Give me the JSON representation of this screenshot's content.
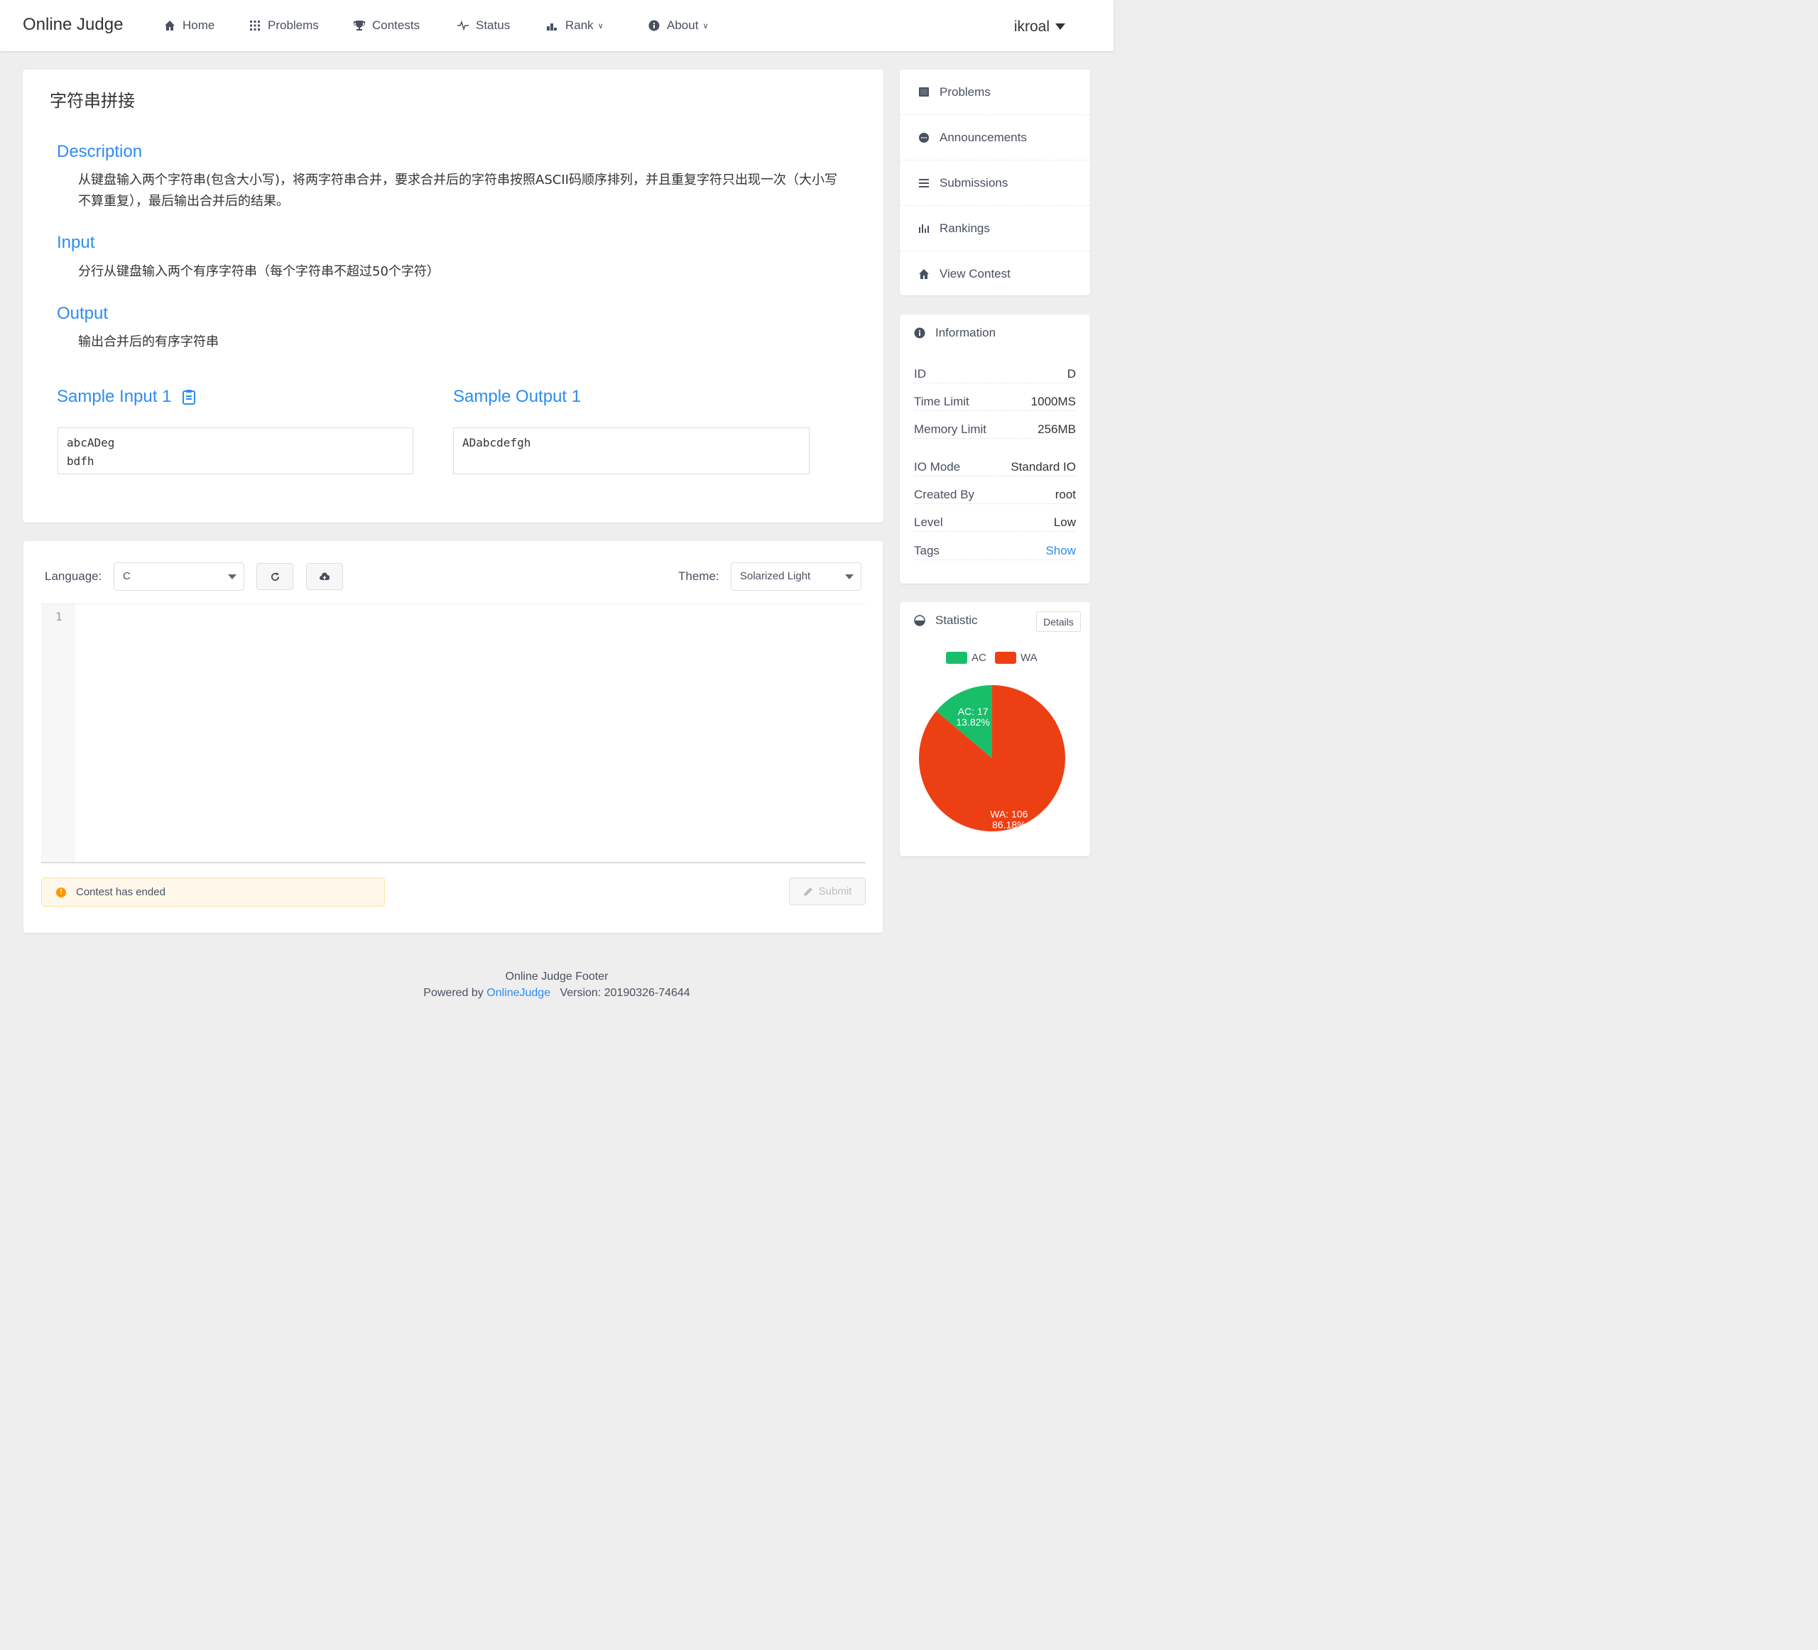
{
  "header": {
    "logo": "Online Judge",
    "nav": [
      {
        "label": "Home",
        "icon": "home-icon"
      },
      {
        "label": "Problems",
        "icon": "grid-icon"
      },
      {
        "label": "Contests",
        "icon": "trophy-icon"
      },
      {
        "label": "Status",
        "icon": "pulse-icon"
      },
      {
        "label": "Rank",
        "icon": "bar-chart-icon"
      },
      {
        "label": "About",
        "icon": "info-icon"
      }
    ],
    "user": "ikroal"
  },
  "problem": {
    "title": "字符串拼接",
    "description_label": "Description",
    "description": "从键盘输入两个字符串(包含大小写)，将两字符串合并，要求合并后的字符串按照ASCII码顺序排列，并且重复字符只出现一次（大小写不算重复），最后输出合并后的结果。",
    "input_label": "Input",
    "input": "分行从键盘输入两个有序字符串（每个字符串不超过50个字符）",
    "output_label": "Output",
    "output": "输出合并后的有序字符串",
    "sample_input_label": "Sample Input 1",
    "sample_input": "abcADeg\nbdfh",
    "sample_output_label": "Sample Output 1",
    "sample_output": "ADabcdefgh"
  },
  "editor": {
    "language_label": "Language:",
    "language": "C",
    "theme_label": "Theme:",
    "theme": "Solarized Light",
    "line_number": "1",
    "alert": "Contest has ended",
    "submit": "Submit"
  },
  "sidebar": {
    "menu": [
      {
        "label": "Problems",
        "icon": "book-icon"
      },
      {
        "label": "Announcements",
        "icon": "chat-icon"
      },
      {
        "label": "Submissions",
        "icon": "list-icon"
      },
      {
        "label": "Rankings",
        "icon": "bar-chart-icon"
      },
      {
        "label": "View Contest",
        "icon": "home-icon"
      }
    ],
    "information": {
      "title": "Information",
      "rows": [
        {
          "k": "ID",
          "v": "D"
        },
        {
          "k": "Time Limit",
          "v": "1000MS"
        },
        {
          "k": "Memory Limit",
          "v": "256MB"
        },
        {
          "k": "IO Mode",
          "v": "Standard IO"
        },
        {
          "k": "Created By",
          "v": "root"
        },
        {
          "k": "Level",
          "v": "Low"
        },
        {
          "k": "Tags",
          "v": "Show"
        }
      ]
    },
    "statistic": {
      "title": "Statistic",
      "details": "Details"
    }
  },
  "chart_data": {
    "type": "pie",
    "categories": [
      "AC",
      "WA"
    ],
    "values": [
      17,
      106
    ],
    "percent_labels": [
      "13.82%",
      "86.18%"
    ],
    "value_labels": [
      "AC: 17",
      "WA: 106"
    ],
    "colors": [
      "#19be6b",
      "#ed3f14"
    ],
    "legend_position": "top"
  },
  "footer": {
    "line1": "Online Judge Footer",
    "powered": "Powered by",
    "link": "OnlineJudge",
    "version": "Version: 20190326-74644"
  }
}
